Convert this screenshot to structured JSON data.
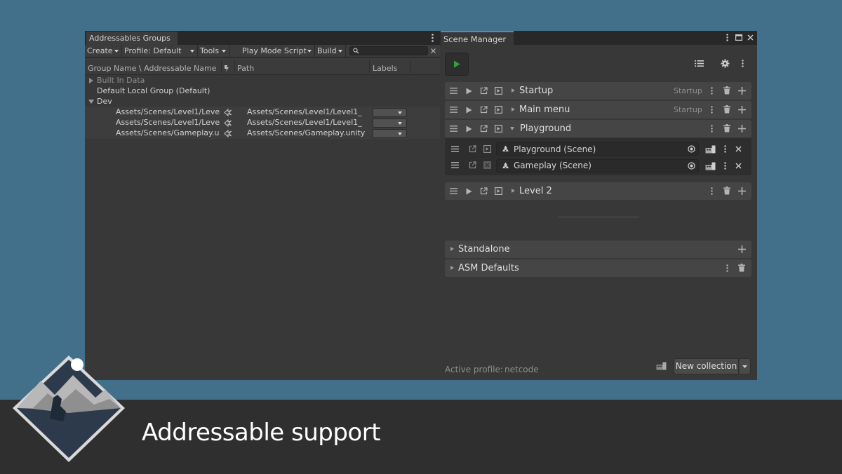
{
  "banner": {
    "title": "Addressable support"
  },
  "addressables": {
    "tab_title": "Addressables Groups",
    "toolbar": {
      "create": "Create",
      "profile": "Profile: Default",
      "tools": "Tools",
      "play_mode_script": "Play Mode Script",
      "build": "Build",
      "search_placeholder": ""
    },
    "columns": {
      "group_name": "Group Name \\ Addressable Name",
      "path": "Path",
      "labels": "Labels"
    },
    "tree": [
      {
        "label": "Built In Data",
        "expanded": false
      },
      {
        "label": "Default Local Group (Default)"
      },
      {
        "label": "Dev",
        "expanded": true
      }
    ],
    "entries": [
      {
        "name": "Assets/Scenes/Level1/Leve",
        "path": "Assets/Scenes/Level1/Level1_"
      },
      {
        "name": "Assets/Scenes/Level1/Leve",
        "path": "Assets/Scenes/Level1/Level1_"
      },
      {
        "name": "Assets/Scenes/Gameplay.u",
        "path": "Assets/Scenes/Gameplay.unity"
      }
    ]
  },
  "scene_manager": {
    "tab_title": "Scene Manager",
    "collections": [
      {
        "title": "Startup",
        "tag": "Startup"
      },
      {
        "title": "Main menu",
        "tag": "Startup"
      },
      {
        "title": "Playground",
        "tag": ""
      },
      {
        "title": "Level 2",
        "tag": ""
      }
    ],
    "scenes": [
      {
        "label": "Playground (Scene)"
      },
      {
        "label": "Gameplay (Scene)"
      }
    ],
    "extra_collections": [
      {
        "title": "Standalone"
      },
      {
        "title": "ASM Defaults"
      }
    ],
    "footer": {
      "active_profile_label": "Active profile:",
      "active_profile_value": "netcode",
      "new_collection": "New collection"
    }
  },
  "colors": {
    "background": "#426f8a",
    "panel": "#383838",
    "play_green": "#2fa43a",
    "tab_accent": "#4a8bd8"
  }
}
